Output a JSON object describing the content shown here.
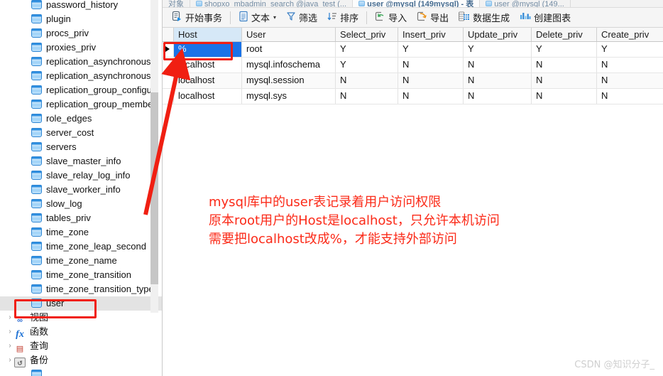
{
  "tabstrip": {
    "tabs": [
      {
        "label": "对象"
      },
      {
        "label": "shopxo_mbadmin_search @java_test (..."
      },
      {
        "label": "user @mysql (149mysql) - 表"
      },
      {
        "label": "user @mysql (149..."
      }
    ]
  },
  "sidebar": {
    "tables": [
      "password_history",
      "plugin",
      "procs_priv",
      "proxies_priv",
      "replication_asynchronous_",
      "replication_asynchronous_",
      "replication_group_configu",
      "replication_group_membe",
      "role_edges",
      "server_cost",
      "servers",
      "slave_master_info",
      "slave_relay_log_info",
      "slave_worker_info",
      "slow_log",
      "tables_priv",
      "time_zone",
      "time_zone_leap_second",
      "time_zone_name",
      "time_zone_transition",
      "time_zone_transition_type",
      "user"
    ],
    "selected_table": "user",
    "groups": [
      {
        "label": "视图",
        "icon": "view-icon"
      },
      {
        "label": "函数",
        "icon": "function-icon"
      },
      {
        "label": "查询",
        "icon": "query-icon"
      },
      {
        "label": "备份",
        "icon": "backup-icon"
      }
    ]
  },
  "toolbar": {
    "buttons": [
      {
        "label": "开始事务",
        "icon": "transaction-icon"
      },
      {
        "label": "文本",
        "icon": "text-icon",
        "caret": "▾"
      },
      {
        "label": "筛选",
        "icon": "filter-icon"
      },
      {
        "label": "排序",
        "icon": "sort-icon"
      },
      {
        "label": "导入",
        "icon": "import-icon"
      },
      {
        "label": "导出",
        "icon": "export-icon"
      },
      {
        "label": "数据生成",
        "icon": "data-generation-icon"
      },
      {
        "label": "创建图表",
        "icon": "create-chart-icon"
      }
    ]
  },
  "grid": {
    "columns": [
      "Host",
      "User",
      "Select_priv",
      "Insert_priv",
      "Update_priv",
      "Delete_priv",
      "Create_priv"
    ],
    "highlighted_column": "Host",
    "rows": [
      {
        "selected": true,
        "cells": [
          "%",
          "root",
          "Y",
          "Y",
          "Y",
          "Y",
          "Y"
        ]
      },
      {
        "selected": false,
        "cells": [
          "localhost",
          "mysql.infoschema",
          "Y",
          "N",
          "N",
          "N",
          "N"
        ]
      },
      {
        "selected": false,
        "cells": [
          "localhost",
          "mysql.session",
          "N",
          "N",
          "N",
          "N",
          "N"
        ]
      },
      {
        "selected": false,
        "cells": [
          "localhost",
          "mysql.sys",
          "N",
          "N",
          "N",
          "N",
          "N"
        ]
      }
    ]
  },
  "annotation": {
    "lines": [
      "mysql库中的user表记录着用户访问权限",
      "原本root用户的Host是localhost，只允许本机访问",
      "需要把localhost改成%，才能支持外部访问"
    ],
    "color": "#fb2a18"
  },
  "watermark": {
    "text": "CSDN @知识分子_"
  }
}
